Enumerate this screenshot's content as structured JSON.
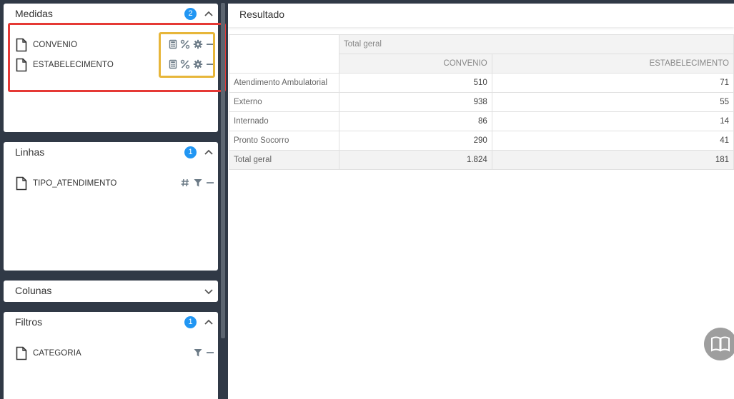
{
  "panels": {
    "medidas": {
      "title": "Medidas",
      "count": "2",
      "fields": [
        {
          "label": "CONVENIO"
        },
        {
          "label": "ESTABELECIMENTO"
        }
      ]
    },
    "linhas": {
      "title": "Linhas",
      "count": "1",
      "fields": [
        {
          "label": "TIPO_ATENDIMENTO"
        }
      ]
    },
    "colunas": {
      "title": "Colunas"
    },
    "filtros": {
      "title": "Filtros",
      "count": "1",
      "fields": [
        {
          "label": "CATEGORIA"
        }
      ]
    }
  },
  "result": {
    "title": "Resultado",
    "table": {
      "group_header": "Total geral",
      "columns": [
        "CONVENIO",
        "ESTABELECIMENTO"
      ],
      "rows": [
        {
          "label": "Atendimento Ambulatorial",
          "values": [
            "510",
            "71"
          ]
        },
        {
          "label": "Externo",
          "values": [
            "938",
            "55"
          ]
        },
        {
          "label": "Internado",
          "values": [
            "86",
            "14"
          ]
        },
        {
          "label": "Pronto Socorro",
          "values": [
            "290",
            "41"
          ]
        }
      ],
      "total": {
        "label": "Total geral",
        "values": [
          "1.824",
          "181"
        ]
      }
    }
  },
  "colors": {
    "accent": "#2196f3",
    "highlight_red": "#e53935",
    "highlight_gold": "#e7b63a",
    "sidebar_bg": "#303946"
  }
}
